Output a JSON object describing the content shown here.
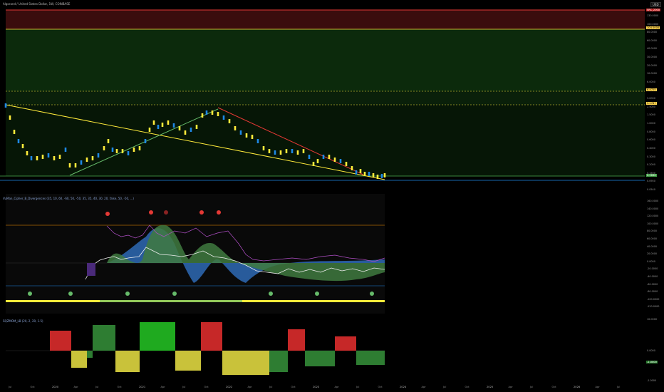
{
  "header": {
    "title": "Algorand / United States Dollar, 1W, COINBASE",
    "currency": "USD"
  },
  "price_pane": {
    "ticks": [
      "130.0000",
      "100.0000",
      "80.0000",
      "60.0000",
      "40.0000",
      "30.0000",
      "20.0000",
      "10.0000",
      "6.0000",
      "4.0000",
      "3.0000",
      "2.5000",
      "1.5000",
      "1.0000",
      "0.8000",
      "0.6000",
      "0.4000",
      "0.3000",
      "0.2000",
      "0.1500",
      "0.0950",
      "0.0540"
    ],
    "tags": [
      {
        "text": "SRC_2000",
        "bg": "#c62828",
        "fg": "#ffffff"
      },
      {
        "text": "104.0000",
        "bg": "#ffd54f",
        "fg": "#000000"
      },
      {
        "text": "6.4725",
        "bg": "#ffd54f",
        "fg": "#000000"
      },
      {
        "text": "3.2787",
        "bg": "#ffd54f",
        "fg": "#000000"
      },
      {
        "text": "0.2630",
        "bg": "#43a047",
        "fg": "#ffffff"
      }
    ]
  },
  "oscillator_pane": {
    "title": "VuMan_Cipher_B_Divergences (35, 10, 60, -60, 50, -50, 35, 35, 40, 30, 20, false, 50, -50, ...)",
    "ticks": [
      "160.0000",
      "140.0000",
      "120.0000",
      "100.0000",
      "80.0000",
      "60.0000",
      "40.0000",
      "20.0000",
      "0.0000",
      "-20.0000",
      "-40.0000",
      "-60.0000",
      "-80.0000",
      "-100.0000",
      "-120.0000"
    ]
  },
  "momentum_pane": {
    "title": "SQZMOM_LB (20, 2, 20, 1.5)",
    "ticks": [
      "10.0000",
      "0.0000",
      "-1.0000"
    ],
    "value_tag": {
      "text": "-1.0000",
      "bg": "#2e7d32",
      "fg": "#ffffff"
    }
  },
  "time_axis": {
    "labels": [
      "Jul",
      "Oct",
      "2020",
      "Apr",
      "Jul",
      "Oct",
      "2021",
      "Apr",
      "Jul",
      "Oct",
      "2022",
      "Apr",
      "Jul",
      "Oct",
      "2023",
      "Apr",
      "Jul",
      "Oct",
      "2024",
      "Apr",
      "Jul",
      "Oct",
      "2025",
      "Apr",
      "Jul",
      "Oct",
      "2026",
      "Apr",
      "Jul"
    ]
  },
  "colors": {
    "bull": "#ffeb3b",
    "bear": "#1e88e5",
    "support": "#4caf50",
    "resistance": "#e53935",
    "wave_top": "#2e6ab5",
    "wave_green": "#3f7a3f",
    "money_flow": "#b14fc7"
  }
}
